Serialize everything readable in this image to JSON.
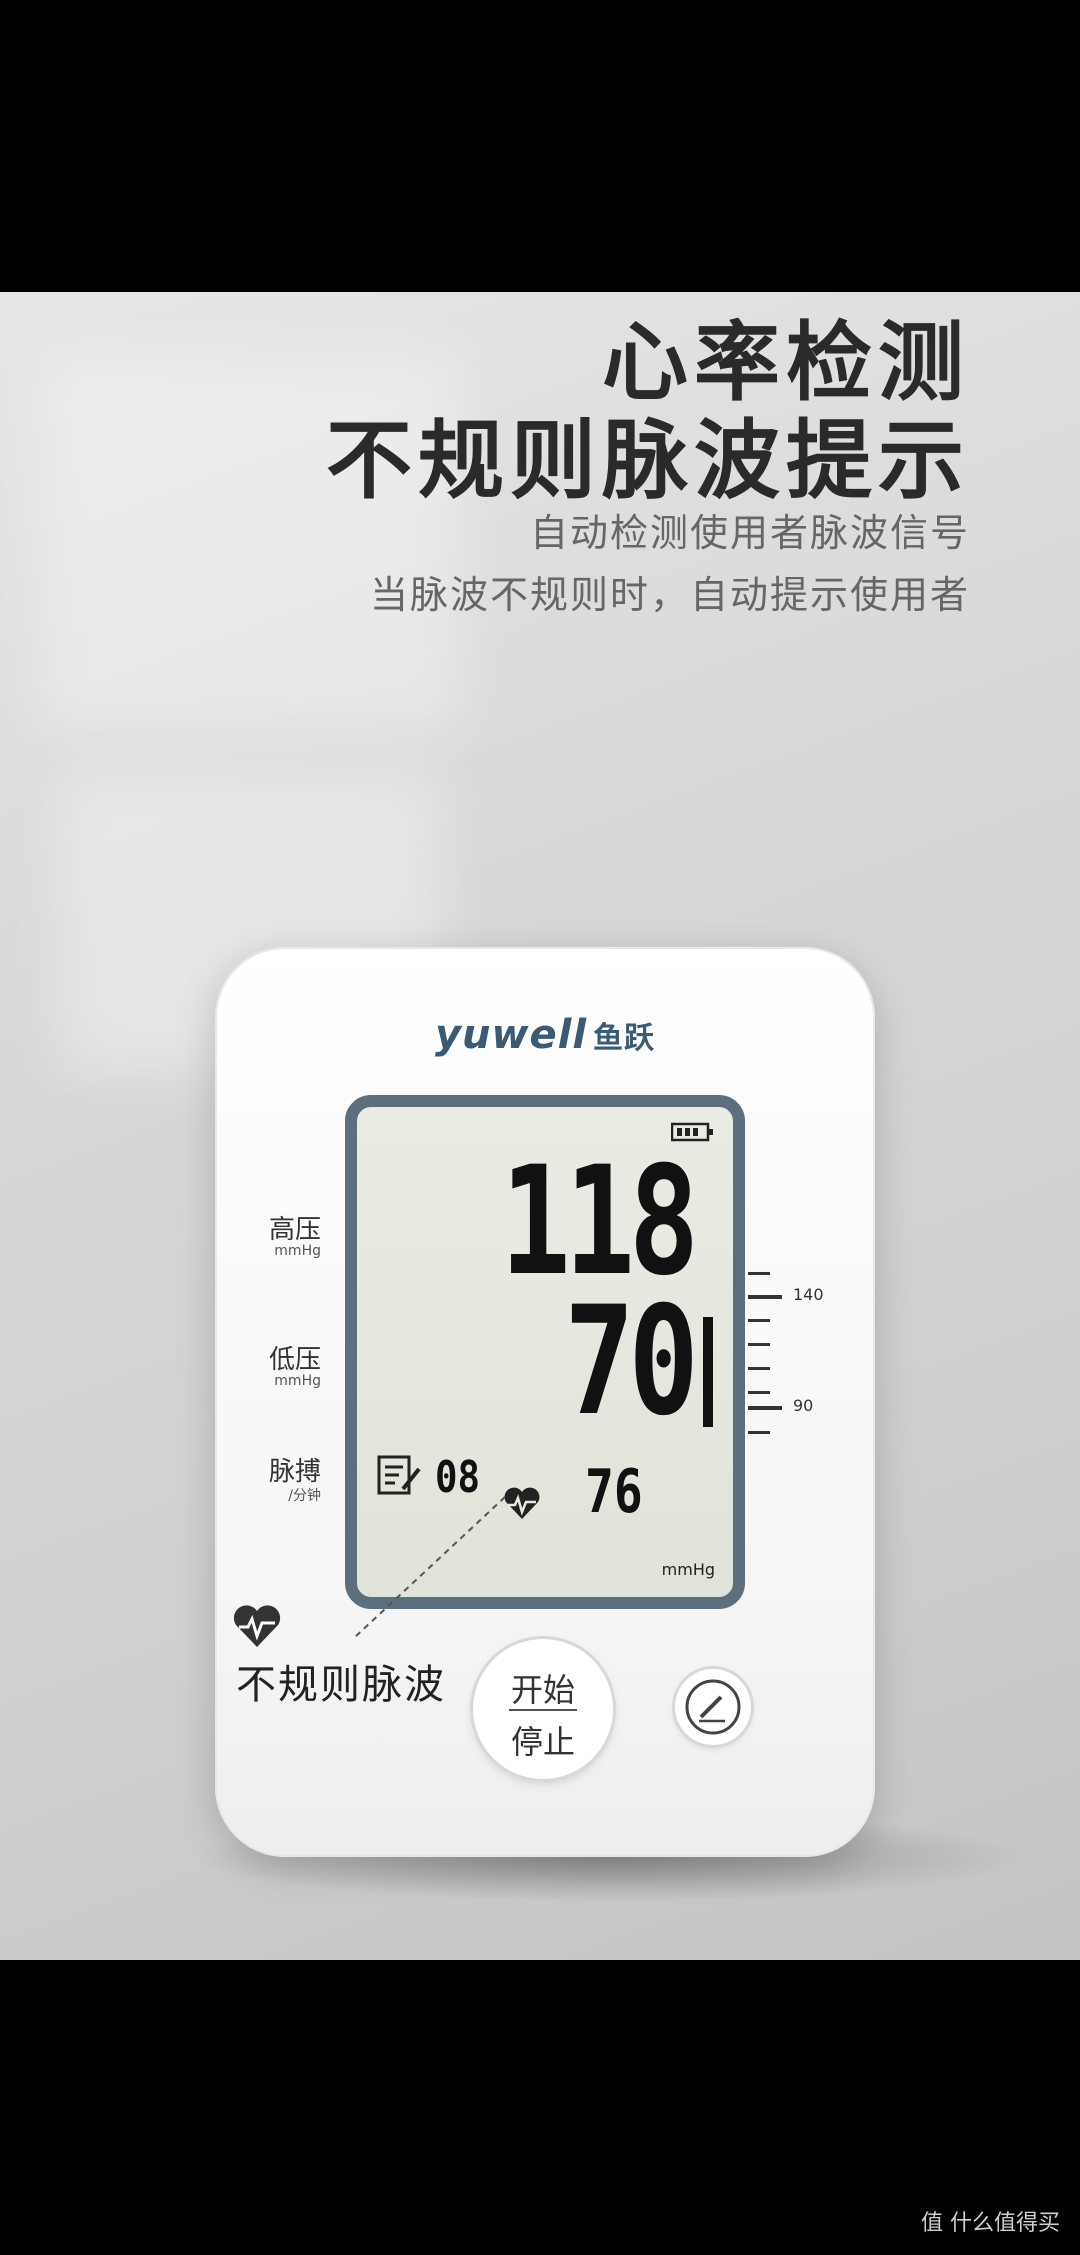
{
  "headline": {
    "line1": "心率检测",
    "line2": "不规则脉波提示"
  },
  "subtext": {
    "line1": "自动检测使用者脉波信号",
    "line2": "当脉波不规则时，自动提示使用者"
  },
  "device": {
    "brand_en": "yuwell",
    "brand_cn": "鱼跃",
    "labels": {
      "systolic": "高压",
      "systolic_unit": "mmHg",
      "diastolic": "低压",
      "diastolic_unit": "mmHg",
      "pulse": "脉搏",
      "pulse_unit": "/分钟"
    },
    "display": {
      "systolic": "118",
      "diastolic": "70",
      "memory": "08",
      "pulse": "76",
      "unit": "mmHg"
    },
    "scale": {
      "upper": "140",
      "lower": "90"
    },
    "buttons": {
      "start_line1": "开始",
      "start_line2": "停止"
    }
  },
  "callout": {
    "label": "不规则脉波"
  },
  "watermark": "值 什么值得买",
  "icons": [
    "battery-icon",
    "heart-icon",
    "memo-icon",
    "pen-icon"
  ]
}
